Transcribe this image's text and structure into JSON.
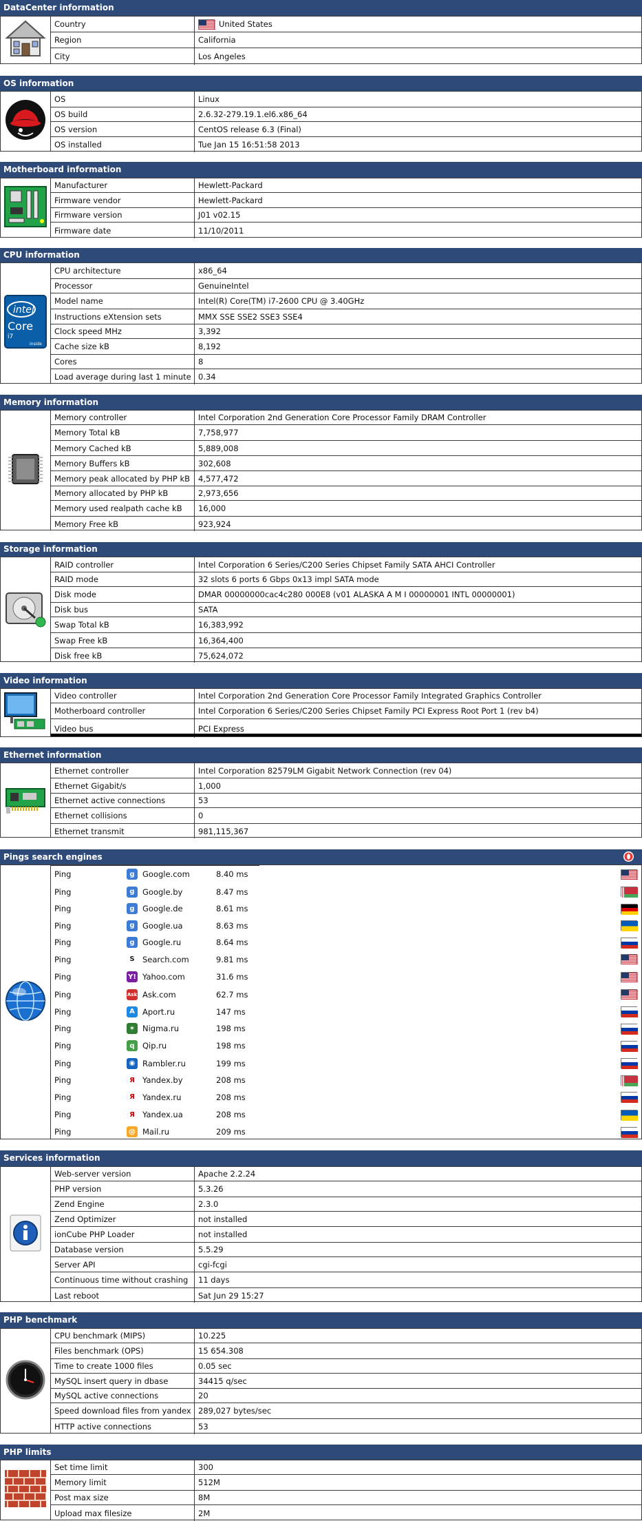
{
  "sections": [
    {
      "id": "datacenter",
      "title": "DataCenter information",
      "icon": "house-icon",
      "rows": [
        {
          "label": "Country",
          "value": "United States",
          "flag": "us"
        },
        {
          "label": "Region",
          "value": "California"
        },
        {
          "label": "City",
          "value": "Los Angeles"
        }
      ]
    },
    {
      "id": "os",
      "title": "OS information",
      "icon": "redhat-icon",
      "rows": [
        {
          "label": "OS",
          "value": "Linux"
        },
        {
          "label": "OS build",
          "value": "2.6.32-279.19.1.el6.x86_64"
        },
        {
          "label": "OS version",
          "value": "CentOS release 6.3 (Final)"
        },
        {
          "label": "OS installed",
          "value": "Tue Jan 15 16:51:58 2013"
        }
      ]
    },
    {
      "id": "motherboard",
      "title": "Motherboard information",
      "icon": "motherboard-icon",
      "rows": [
        {
          "label": "Manufacturer",
          "value": "Hewlett-Packard"
        },
        {
          "label": "Firmware vendor",
          "value": "Hewlett-Packard"
        },
        {
          "label": "Firmware version",
          "value": "J01 v02.15"
        },
        {
          "label": "Firmware date",
          "value": "11/10/2011"
        }
      ]
    },
    {
      "id": "cpu",
      "title": "CPU information",
      "icon": "intel-core-i7-icon",
      "rows": [
        {
          "label": "CPU architecture",
          "value": "x86_64"
        },
        {
          "label": "Processor",
          "value": "GenuineIntel"
        },
        {
          "label": "Model name",
          "value": "Intel(R) Core(TM) i7-2600 CPU @ 3.40GHz"
        },
        {
          "label": "Instructions eXtension sets",
          "value": "MMX SSE SSE2 SSE3 SSE4"
        },
        {
          "label": "Clock speed MHz",
          "value": "3,392"
        },
        {
          "label": "Cache size kB",
          "value": "8,192"
        },
        {
          "label": "Cores",
          "value": "8"
        },
        {
          "label": "Load average during last 1 minute",
          "value": "0.34"
        }
      ]
    },
    {
      "id": "memory",
      "title": "Memory information",
      "icon": "memory-chip-icon",
      "rows": [
        {
          "label": "Memory controller",
          "value": "Intel Corporation 2nd Generation Core Processor Family DRAM Controller"
        },
        {
          "label": "Memory Total kB",
          "value": "7,758,977"
        },
        {
          "label": "Memory Cached kB",
          "value": "5,889,008"
        },
        {
          "label": "Memory Buffers kB",
          "value": "302,608"
        },
        {
          "label": "Memory peak allocated by PHP kB",
          "value": "4,577,472"
        },
        {
          "label": "Memory allocated by PHP kB",
          "value": "2,973,656"
        },
        {
          "label": "Memory used realpath cache kB",
          "value": "16,000"
        },
        {
          "label": "Memory Free kB",
          "value": "923,924"
        }
      ]
    },
    {
      "id": "storage",
      "title": "Storage information",
      "icon": "hard-disk-icon",
      "rows": [
        {
          "label": "RAID controller",
          "value": "Intel Corporation 6 Series/C200 Series Chipset Family SATA AHCI Controller"
        },
        {
          "label": "RAID mode",
          "value": "32 slots 6 ports 6 Gbps 0x13 impl SATA mode"
        },
        {
          "label": "Disk mode",
          "value": "DMAR 00000000cac4c280 000E8 (v01 ALASKA A M I 00000001 INTL 00000001)"
        },
        {
          "label": "Disk bus",
          "value": "SATA"
        },
        {
          "label": "Swap Total kB",
          "value": "16,383,992"
        },
        {
          "label": "Swap Free kB",
          "value": "16,364,400"
        },
        {
          "label": "Disk free kB",
          "value": "75,624,072"
        }
      ]
    },
    {
      "id": "video",
      "title": "Video information",
      "icon": "video-card-icon",
      "rows": [
        {
          "label": "Video controller",
          "value": "Intel Corporation 2nd Generation Core Processor Family Integrated Graphics Controller"
        },
        {
          "label": "Motherboard controller",
          "value": "Intel Corporation 6 Series/C200 Series Chipset Family PCI Express Root Port 1 (rev b4)"
        },
        {
          "label": "Video bus",
          "value": "PCI Express"
        }
      ]
    },
    {
      "id": "ethernet",
      "title": "Ethernet information",
      "icon": "network-card-icon",
      "rows": [
        {
          "label": "Ethernet controller",
          "value": "Intel Corporation 82579LM Gigabit Network Connection (rev 04)"
        },
        {
          "label": "Ethernet Gigabit/s",
          "value": "1,000"
        },
        {
          "label": "Ethernet active connections",
          "value": "53"
        },
        {
          "label": "Ethernet collisions",
          "value": "0"
        },
        {
          "label": "Ethernet transmit",
          "value": "981,115,367"
        }
      ]
    },
    {
      "id": "pings",
      "title": "Pings search engines",
      "icon": "globe-icon",
      "rows": [
        {
          "label": "Ping",
          "engine": "Google.com",
          "ms": "8.40 ms",
          "engine_icon": "google-icon",
          "flag": "us"
        },
        {
          "label": "Ping",
          "engine": "Google.by",
          "ms": "8.47 ms",
          "engine_icon": "google-icon",
          "flag": "by"
        },
        {
          "label": "Ping",
          "engine": "Google.de",
          "ms": "8.61 ms",
          "engine_icon": "google-icon",
          "flag": "de"
        },
        {
          "label": "Ping",
          "engine": "Google.ua",
          "ms": "8.63 ms",
          "engine_icon": "google-icon",
          "flag": "ua"
        },
        {
          "label": "Ping",
          "engine": "Google.ru",
          "ms": "8.64 ms",
          "engine_icon": "google-icon",
          "flag": "ru"
        },
        {
          "label": "Ping",
          "engine": "Search.com",
          "ms": "9.81 ms",
          "engine_icon": "search-com-icon",
          "flag": "us"
        },
        {
          "label": "Ping",
          "engine": "Yahoo.com",
          "ms": "31.6 ms",
          "engine_icon": "yahoo-icon",
          "flag": "us"
        },
        {
          "label": "Ping",
          "engine": "Ask.com",
          "ms": "62.7 ms",
          "engine_icon": "ask-icon",
          "flag": "us"
        },
        {
          "label": "Ping",
          "engine": "Aport.ru",
          "ms": "147 ms",
          "engine_icon": "aport-icon",
          "flag": "ru"
        },
        {
          "label": "Ping",
          "engine": "Nigma.ru",
          "ms": "198 ms",
          "engine_icon": "nigma-icon",
          "flag": "ru"
        },
        {
          "label": "Ping",
          "engine": "Qip.ru",
          "ms": "198 ms",
          "engine_icon": "qip-icon",
          "flag": "ru"
        },
        {
          "label": "Ping",
          "engine": "Rambler.ru",
          "ms": "199 ms",
          "engine_icon": "rambler-icon",
          "flag": "ru"
        },
        {
          "label": "Ping",
          "engine": "Yandex.by",
          "ms": "208 ms",
          "engine_icon": "yandex-icon",
          "flag": "by"
        },
        {
          "label": "Ping",
          "engine": "Yandex.ru",
          "ms": "208 ms",
          "engine_icon": "yandex-icon",
          "flag": "ru"
        },
        {
          "label": "Ping",
          "engine": "Yandex.ua",
          "ms": "208 ms",
          "engine_icon": "yandex-icon",
          "flag": "ua"
        },
        {
          "label": "Ping",
          "engine": "Mail.ru",
          "ms": "209 ms",
          "engine_icon": "mail-ru-icon",
          "flag": "ru"
        }
      ]
    },
    {
      "id": "services",
      "title": "Services information",
      "icon": "info-icon",
      "rows": [
        {
          "label": "Web-server version",
          "value": "Apache 2.2.24"
        },
        {
          "label": "PHP version",
          "value": "5.3.26"
        },
        {
          "label": "Zend Engine",
          "value": "2.3.0"
        },
        {
          "label": "Zend Optimizer",
          "value": "not installed"
        },
        {
          "label": "ionCube PHP Loader",
          "value": "not installed"
        },
        {
          "label": "Database version",
          "value": "5.5.29"
        },
        {
          "label": "Server API",
          "value": "cgi-fcgi"
        },
        {
          "label": "Continuous time without crashing",
          "value": "11 days"
        },
        {
          "label": "Last reboot",
          "value": "Sat Jun 29 15:27"
        }
      ]
    },
    {
      "id": "benchmark",
      "title": "PHP benchmark",
      "icon": "clock-icon",
      "rows": [
        {
          "label": "CPU benchmark (MIPS)",
          "value": "10.225"
        },
        {
          "label": "Files benchmark (OPS)",
          "value": "15 654.308"
        },
        {
          "label": "Time to create 1000 files",
          "value": "0.05 sec"
        },
        {
          "label": "MySQL insert query in dbase",
          "value": "34415 q/sec"
        },
        {
          "label": "MySQL active connections",
          "value": "20"
        },
        {
          "label": "Speed download files from yandex",
          "value": "289,027 bytes/sec"
        },
        {
          "label": "HTTP active connections",
          "value": "53"
        }
      ]
    },
    {
      "id": "limits",
      "title": "PHP limits",
      "icon": "brick-wall-icon",
      "rows": [
        {
          "label": "Set time limit",
          "value": "300"
        },
        {
          "label": "Memory limit",
          "value": "512M"
        },
        {
          "label": "Post max size",
          "value": "8M"
        },
        {
          "label": "Upload max filesize",
          "value": "2M"
        }
      ]
    }
  ],
  "colors": {
    "header_bg": "#2e4a78",
    "header_text": "#ffffff",
    "border": "#3a3a3a"
  }
}
